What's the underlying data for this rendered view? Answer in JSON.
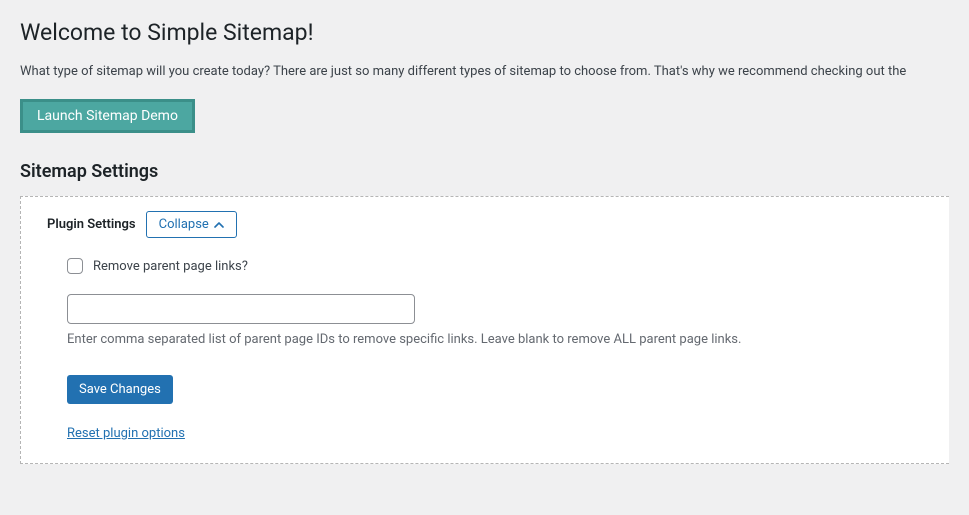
{
  "page": {
    "title": "Welcome to Simple Sitemap!",
    "intro": "What type of sitemap will you create today? There are just so many different types of sitemap to choose from. That's why we recommend checking out the",
    "launch_button": "Launch Sitemap Demo",
    "settings_heading": "Sitemap Settings"
  },
  "panel": {
    "title": "Plugin Settings",
    "collapse_label": "Collapse",
    "checkbox_label": "Remove parent page links?",
    "input_value": "",
    "input_placeholder": "",
    "help_text": "Enter comma separated list of parent page IDs to remove specific links. Leave blank to remove ALL parent page links.",
    "save_button": "Save Changes",
    "reset_link": "Reset plugin options"
  }
}
